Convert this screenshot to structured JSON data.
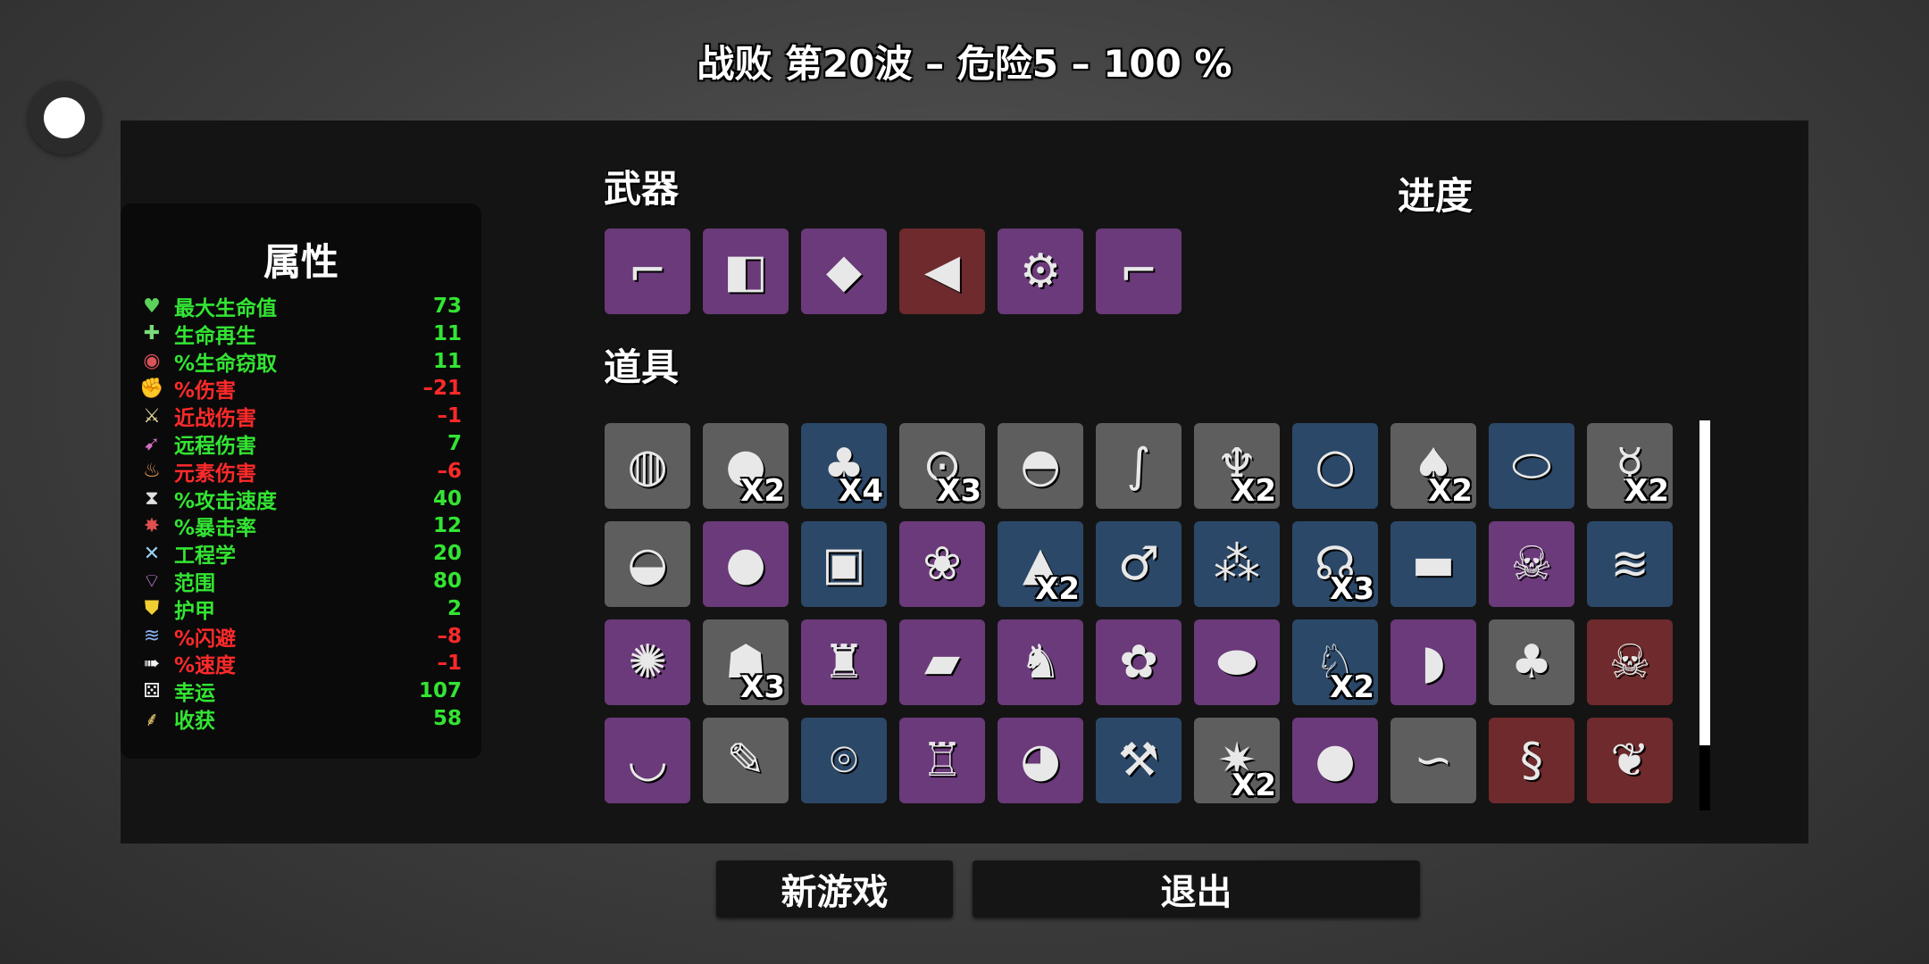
{
  "header": {
    "title": "战败 第20波 – 危险5 – 100 %"
  },
  "stats": {
    "title": "属性",
    "items": [
      {
        "icon": "heart-icon",
        "glyph": "♥",
        "label": "最大生命值",
        "value": "73",
        "color": "#33e533",
        "icon_color": "#5bd35b"
      },
      {
        "icon": "heart-regen-icon",
        "glyph": "✚",
        "label": "生命再生",
        "value": "11",
        "color": "#33e533",
        "icon_color": "#7ad97a"
      },
      {
        "icon": "lifesteal-fang-icon",
        "glyph": "◉",
        "label": "%生命窃取",
        "value": "11",
        "color": "#33e533",
        "icon_color": "#d9535b"
      },
      {
        "icon": "damage-fist-icon",
        "glyph": "✊",
        "label": "%伤害",
        "value": "–21",
        "color": "#ff2a2a",
        "icon_color": "#e07070"
      },
      {
        "icon": "melee-sword-icon",
        "glyph": "⚔",
        "label": "近战伤害",
        "value": "–1",
        "color": "#ff2a2a",
        "icon_color": "#e8e0a0"
      },
      {
        "icon": "ranged-bow-icon",
        "glyph": "➹",
        "label": "远程伤害",
        "value": "7",
        "color": "#33e533",
        "icon_color": "#d070c0"
      },
      {
        "icon": "elemental-flame-icon",
        "glyph": "♨",
        "label": "元素伤害",
        "value": "–6",
        "color": "#ff2a2a",
        "icon_color": "#f0a060"
      },
      {
        "icon": "attack-speed-hourglass-icon",
        "glyph": "⧗",
        "label": "%攻击速度",
        "value": "40",
        "color": "#33e533",
        "icon_color": "#e0e0e0"
      },
      {
        "icon": "crit-chance-icon",
        "glyph": "✸",
        "label": "%暴击率",
        "value": "12",
        "color": "#33e533",
        "icon_color": "#e05050"
      },
      {
        "icon": "engineering-wrench-icon",
        "glyph": "✕",
        "label": "工程学",
        "value": "20",
        "color": "#33e533",
        "icon_color": "#9ad0f0"
      },
      {
        "icon": "range-signal-icon",
        "glyph": "⌔",
        "label": "范围",
        "value": "80",
        "color": "#33e533",
        "icon_color": "#c080e0"
      },
      {
        "icon": "armor-shield-icon",
        "glyph": "⛊",
        "label": "护甲",
        "value": "2",
        "color": "#33e533",
        "icon_color": "#f0d030"
      },
      {
        "icon": "dodge-icon",
        "glyph": "≋",
        "label": "%闪避",
        "value": "–8",
        "color": "#ff2a2a",
        "icon_color": "#8ab0f0"
      },
      {
        "icon": "speed-boot-icon",
        "glyph": "➠",
        "label": "%速度",
        "value": "–1",
        "color": "#ff2a2a",
        "icon_color": "#f0f0f0"
      },
      {
        "icon": "luck-dice-icon",
        "glyph": "⚄",
        "label": "幸运",
        "value": "107",
        "color": "#33e533",
        "icon_color": "#f0f0f0"
      },
      {
        "icon": "harvest-wheat-icon",
        "glyph": "⸙",
        "label": "收获",
        "value": "58",
        "color": "#33e533",
        "icon_color": "#f0d070"
      }
    ]
  },
  "weapons": {
    "label": "武器",
    "items": [
      {
        "icon": "laser-gun-icon",
        "glyph": "⌐",
        "bg": "#6b3a7a"
      },
      {
        "icon": "siren-blaster-icon",
        "glyph": "◧",
        "bg": "#6b3a7a"
      },
      {
        "icon": "crystal-shard-icon",
        "glyph": "◆",
        "bg": "#6b3a7a"
      },
      {
        "icon": "megaphone-gun-icon",
        "glyph": "◀",
        "bg": "#6e2a2c"
      },
      {
        "icon": "minigun-icon",
        "glyph": "⚙",
        "bg": "#6b3a7a"
      },
      {
        "icon": "revolver-icon",
        "glyph": "⌐",
        "bg": "#6b3a7a"
      }
    ]
  },
  "progress": {
    "label": "进度"
  },
  "items": {
    "label": "道具",
    "rows": [
      [
        {
          "icon": "egg-face-icon",
          "glyph": "◍",
          "bg": "#5e5e5e",
          "count": ""
        },
        {
          "icon": "boxing-glove-icon",
          "glyph": "●",
          "bg": "#5e5e5e",
          "count": "X2"
        },
        {
          "icon": "plant-desk-icon",
          "glyph": "♣",
          "bg": "#2c4868",
          "count": "X4"
        },
        {
          "icon": "ufo-toy-icon",
          "glyph": "⊙",
          "bg": "#5e5e5e",
          "count": "X3"
        },
        {
          "icon": "helmet-icon",
          "glyph": "◓",
          "bg": "#5e5e5e",
          "count": ""
        },
        {
          "icon": "worm-icon",
          "glyph": "∫",
          "bg": "#5e5e5e",
          "count": ""
        },
        {
          "icon": "robot-arm-icon",
          "glyph": "♆",
          "bg": "#5e5e5e",
          "count": "X2"
        },
        {
          "icon": "pendant-necklace-icon",
          "glyph": "○",
          "bg": "#2c4868",
          "count": ""
        },
        {
          "icon": "mushroom-hand-icon",
          "glyph": "♠",
          "bg": "#5e5e5e",
          "count": "X2"
        },
        {
          "icon": "cocoon-icon",
          "glyph": "⬭",
          "bg": "#2c4868",
          "count": ""
        },
        {
          "icon": "voodoo-doll-icon",
          "glyph": "☿",
          "bg": "#5e5e5e",
          "count": "X2"
        }
      ],
      [
        {
          "icon": "propeller-cap-icon",
          "glyph": "◒",
          "bg": "#5e5e5e",
          "count": ""
        },
        {
          "icon": "jelly-blob-icon",
          "glyph": "●",
          "bg": "#6b3a7a",
          "count": ""
        },
        {
          "icon": "sewing-machine-icon",
          "glyph": "▣",
          "bg": "#2c4868",
          "count": ""
        },
        {
          "icon": "mushroom-cluster-icon",
          "glyph": "❀",
          "bg": "#6b3a7a",
          "count": ""
        },
        {
          "icon": "rocket-icon",
          "glyph": "▲",
          "bg": "#2c4868",
          "count": "X2"
        },
        {
          "icon": "lighter-icon",
          "glyph": "♂",
          "bg": "#2c4868",
          "count": ""
        },
        {
          "icon": "bloody-pellets-icon",
          "glyph": "⁂",
          "bg": "#2c4868",
          "count": ""
        },
        {
          "icon": "metal-claw-icon",
          "glyph": "☊",
          "bg": "#2c4868",
          "count": "X3"
        },
        {
          "icon": "sunglasses-icon",
          "glyph": "▬",
          "bg": "#2c4868",
          "count": ""
        },
        {
          "icon": "skull-bomb-icon",
          "glyph": "☠",
          "bg": "#6b3a7a",
          "count": ""
        },
        {
          "icon": "scarf-wrap-icon",
          "glyph": "≋",
          "bg": "#2c4868",
          "count": ""
        }
      ],
      [
        {
          "icon": "peacock-icon",
          "glyph": "✺",
          "bg": "#6b3a7a",
          "count": ""
        },
        {
          "icon": "ghost-cloak-icon",
          "glyph": "☗",
          "bg": "#5e5e5e",
          "count": "X3"
        },
        {
          "icon": "scarecrow-icon",
          "glyph": "♜",
          "bg": "#6b3a7a",
          "count": ""
        },
        {
          "icon": "toolbox-icon",
          "glyph": "▰",
          "bg": "#6b3a7a",
          "count": ""
        },
        {
          "icon": "lucky-cat-icon",
          "glyph": "♞",
          "bg": "#6b3a7a",
          "count": ""
        },
        {
          "icon": "brain-icon",
          "glyph": "✿",
          "bg": "#6b3a7a",
          "count": ""
        },
        {
          "icon": "tardigrade-icon",
          "glyph": "⬬",
          "bg": "#6b3a7a",
          "count": ""
        },
        {
          "icon": "rabbit-icon",
          "glyph": "♘",
          "bg": "#2c4868",
          "count": "X2"
        },
        {
          "icon": "red-scarf-icon",
          "glyph": "◗",
          "bg": "#6b3a7a",
          "count": ""
        },
        {
          "icon": "tree-icon",
          "glyph": "♣",
          "bg": "#5e5e5e",
          "count": ""
        },
        {
          "icon": "cursed-chest-icon",
          "glyph": "☠",
          "bg": "#6e2a2c",
          "count": ""
        }
      ],
      [
        {
          "icon": "mortar-pestle-icon",
          "glyph": "◡",
          "bg": "#6b3a7a",
          "count": ""
        },
        {
          "icon": "syringe-icon",
          "glyph": "✎",
          "bg": "#5e5e5e",
          "count": ""
        },
        {
          "icon": "stone-circle-icon",
          "glyph": "⌾",
          "bg": "#2c4868",
          "count": ""
        },
        {
          "icon": "exoskeleton-icon",
          "glyph": "♖",
          "bg": "#6b3a7a",
          "count": ""
        },
        {
          "icon": "knight-helmet-icon",
          "glyph": "◕",
          "bg": "#6b3a7a",
          "count": ""
        },
        {
          "icon": "wheelbarrow-icon",
          "glyph": "⚒",
          "bg": "#2c4868",
          "count": ""
        },
        {
          "icon": "dynamite-icon",
          "glyph": "✷",
          "bg": "#5e5e5e",
          "count": "X2"
        },
        {
          "icon": "tomato-face-icon",
          "glyph": "●",
          "bg": "#6b3a7a",
          "count": ""
        },
        {
          "icon": "lizard-icon",
          "glyph": "∽",
          "bg": "#5e5e5e",
          "count": ""
        },
        {
          "icon": "scroll-icon",
          "glyph": "§",
          "bg": "#6e2a2c",
          "count": ""
        },
        {
          "icon": "rainbow-leaf-icon",
          "glyph": "❦",
          "bg": "#6e2a2c",
          "count": ""
        }
      ]
    ]
  },
  "buttons": {
    "new_game": "新游戏",
    "exit": "退出"
  }
}
